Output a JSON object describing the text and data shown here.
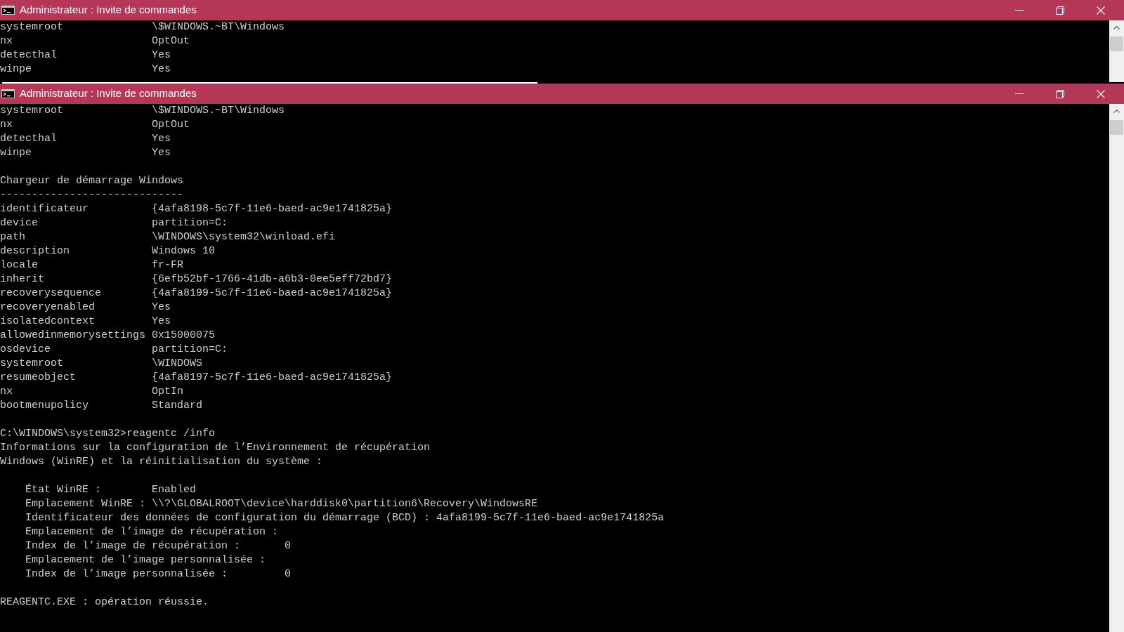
{
  "windows": [
    {
      "title": "Administrateur : Invite de commandes",
      "blocks": [
        [
          {
            "kind": "pair",
            "key": "systemroot",
            "value": "\\$WINDOWS.~BT\\Windows"
          },
          {
            "kind": "pair",
            "key": "nx",
            "value": "OptOut"
          },
          {
            "kind": "pair",
            "key": "detecthal",
            "value": "Yes"
          },
          {
            "kind": "pair",
            "key": "winpe",
            "value": "Yes"
          }
        ]
      ]
    },
    {
      "title": "Administrateur : Invite de commandes",
      "blocks": [
        [
          {
            "kind": "pair",
            "key": "systemroot",
            "value": "\\$WINDOWS.~BT\\Windows"
          },
          {
            "kind": "pair",
            "key": "nx",
            "value": "OptOut"
          },
          {
            "kind": "pair",
            "key": "detecthal",
            "value": "Yes"
          },
          {
            "kind": "pair",
            "key": "winpe",
            "value": "Yes"
          }
        ],
        [
          {
            "kind": "text",
            "text": "Chargeur de démarrage Windows"
          },
          {
            "kind": "text",
            "text": "-----------------------------"
          },
          {
            "kind": "pair",
            "key": "identificateur",
            "value": "{4afa8198-5c7f-11e6-baed-ac9e1741825a}"
          },
          {
            "kind": "pair",
            "key": "device",
            "value": "partition=C:"
          },
          {
            "kind": "pair",
            "key": "path",
            "value": "\\WINDOWS\\system32\\winload.efi"
          },
          {
            "kind": "pair",
            "key": "description",
            "value": "Windows 10"
          },
          {
            "kind": "pair",
            "key": "locale",
            "value": "fr-FR"
          },
          {
            "kind": "pair",
            "key": "inherit",
            "value": "{6efb52bf-1766-41db-a6b3-0ee5eff72bd7}"
          },
          {
            "kind": "pair",
            "key": "recoverysequence",
            "value": "{4afa8199-5c7f-11e6-baed-ac9e1741825a}"
          },
          {
            "kind": "pair",
            "key": "recoveryenabled",
            "value": "Yes"
          },
          {
            "kind": "pair",
            "key": "isolatedcontext",
            "value": "Yes"
          },
          {
            "kind": "pair",
            "key": "allowedinmemorysettings",
            "value": "0x15000075"
          },
          {
            "kind": "pair",
            "key": "osdevice",
            "value": "partition=C:"
          },
          {
            "kind": "pair",
            "key": "systemroot",
            "value": "\\WINDOWS"
          },
          {
            "kind": "pair",
            "key": "resumeobject",
            "value": "{4afa8197-5c7f-11e6-baed-ac9e1741825a}"
          },
          {
            "kind": "pair",
            "key": "nx",
            "value": "OptIn"
          },
          {
            "kind": "pair",
            "key": "bootmenupolicy",
            "value": "Standard"
          }
        ],
        [
          {
            "kind": "text",
            "text": "C:\\WINDOWS\\system32>reagentc /info"
          },
          {
            "kind": "text",
            "text": "Informations sur la configuration de l’Environnement de récupération"
          },
          {
            "kind": "text",
            "text": "Windows (WinRE) et la réinitialisation du système :"
          }
        ],
        [
          {
            "kind": "group",
            "children": [
              {
                "kind": "pair",
                "key": "État WinRE :",
                "value": "Enabled"
              },
              {
                "kind": "pair",
                "key": "Emplacement WinRE :",
                "value": "\\\\?\\GLOBALROOT\\device\\harddisk0\\partition6\\Recovery\\WindowsRE"
              },
              {
                "kind": "pair",
                "key": "Identificateur des données de configuration du démarrage (BCD) :",
                "value": "4afa8199-5c7f-11e6-baed-ac9e1741825a"
              },
              {
                "kind": "text",
                "text": "Emplacement de l’image de récupération :"
              },
              {
                "kind": "wide_pair",
                "key": "Index de l’image de récupération :",
                "value": "0"
              },
              {
                "kind": "text",
                "text": "Emplacement de l’image personnalisée :"
              },
              {
                "kind": "wide_pair",
                "key": "Index de l’image personnalisée :",
                "value": "0"
              }
            ]
          }
        ],
        [
          {
            "kind": "text",
            "text": "REAGENTC.EXE : opération réussie."
          }
        ]
      ]
    }
  ]
}
